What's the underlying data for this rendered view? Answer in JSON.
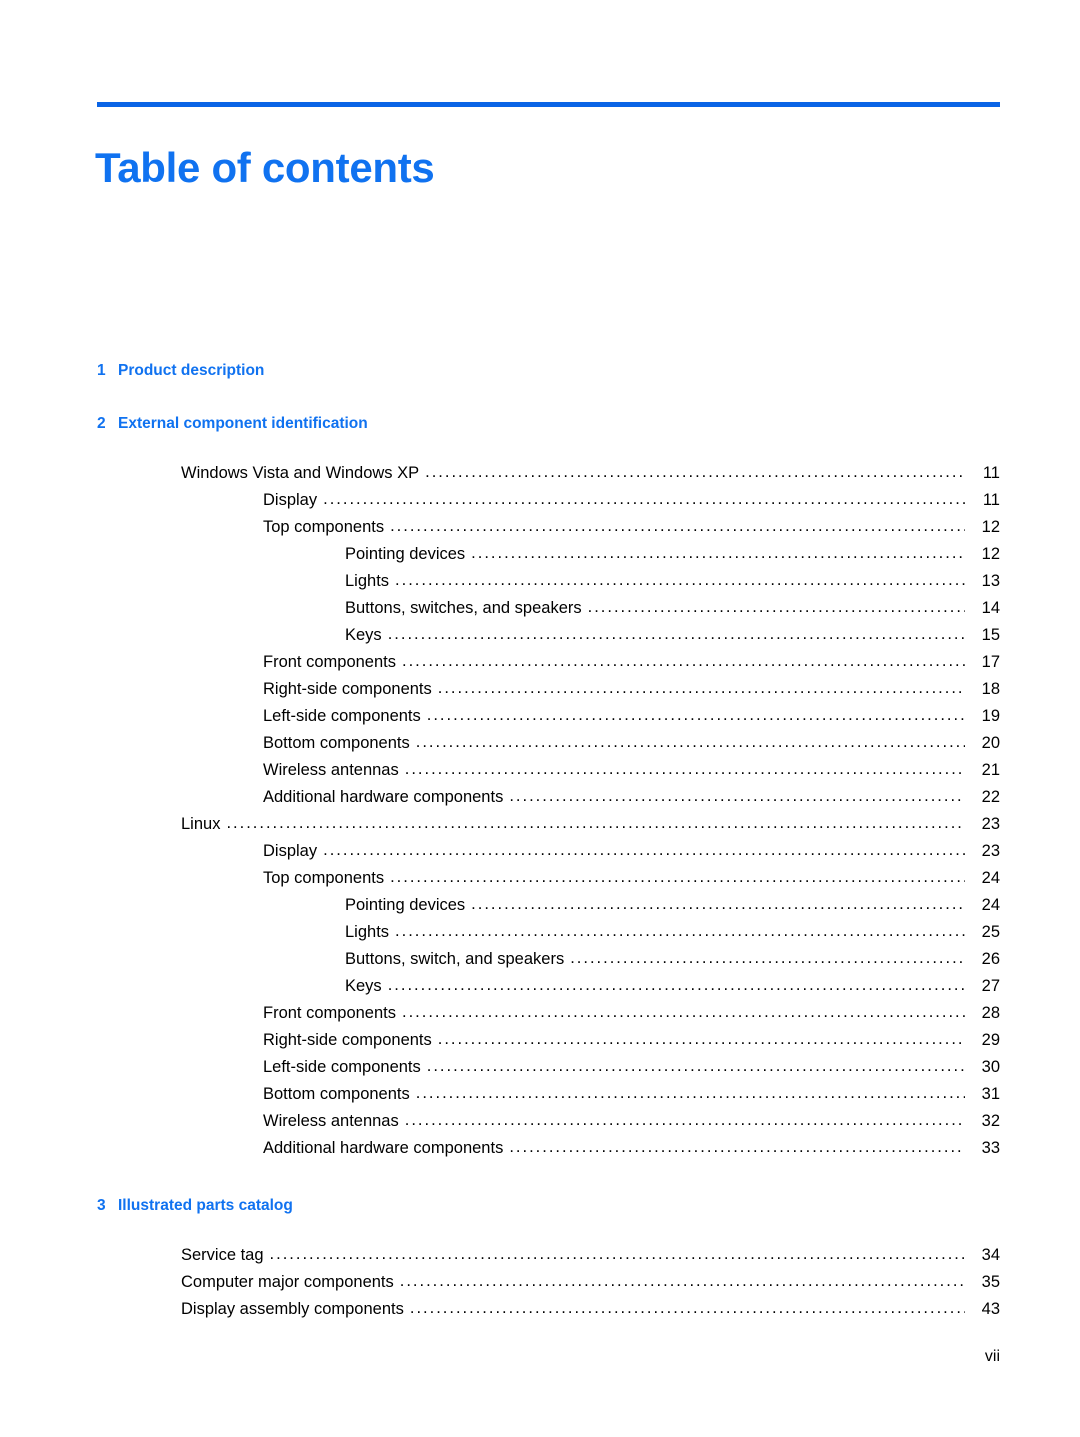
{
  "document": {
    "title": "Table of contents",
    "accent_color": "#1072F0",
    "rule_color": "#0A64E6",
    "footer_page_number": "vii"
  },
  "leader_dots": "...........................................................................................................................................................................................................................................",
  "chapters": [
    {
      "number": "1",
      "label": "Product description",
      "entries": []
    },
    {
      "number": "2",
      "label": "External component identification",
      "entries": [
        {
          "level": 1,
          "text": "Windows Vista and Windows XP",
          "page": "11"
        },
        {
          "level": 2,
          "text": "Display",
          "page": "11"
        },
        {
          "level": 2,
          "text": "Top components",
          "page": "12"
        },
        {
          "level": 3,
          "text": "Pointing devices",
          "page": "12"
        },
        {
          "level": 3,
          "text": "Lights",
          "page": "13"
        },
        {
          "level": 3,
          "text": "Buttons, switches, and speakers",
          "page": "14"
        },
        {
          "level": 3,
          "text": "Keys",
          "page": "15"
        },
        {
          "level": 2,
          "text": "Front components",
          "page": "17"
        },
        {
          "level": 2,
          "text": "Right-side components",
          "page": "18"
        },
        {
          "level": 2,
          "text": "Left-side components",
          "page": "19"
        },
        {
          "level": 2,
          "text": "Bottom components",
          "page": "20"
        },
        {
          "level": 2,
          "text": "Wireless antennas",
          "page": "21"
        },
        {
          "level": 2,
          "text": "Additional hardware components",
          "page": "22"
        },
        {
          "level": 1,
          "text": "Linux",
          "page": "23"
        },
        {
          "level": 2,
          "text": "Display",
          "page": "23"
        },
        {
          "level": 2,
          "text": "Top components",
          "page": "24"
        },
        {
          "level": 3,
          "text": "Pointing devices",
          "page": "24"
        },
        {
          "level": 3,
          "text": "Lights",
          "page": "25"
        },
        {
          "level": 3,
          "text": "Buttons, switch, and speakers",
          "page": "26"
        },
        {
          "level": 3,
          "text": "Keys",
          "page": "27"
        },
        {
          "level": 2,
          "text": "Front components",
          "page": "28"
        },
        {
          "level": 2,
          "text": "Right-side components",
          "page": "29"
        },
        {
          "level": 2,
          "text": "Left-side components",
          "page": "30"
        },
        {
          "level": 2,
          "text": "Bottom components",
          "page": "31"
        },
        {
          "level": 2,
          "text": "Wireless antennas",
          "page": "32"
        },
        {
          "level": 2,
          "text": "Additional hardware components",
          "page": "33"
        }
      ]
    },
    {
      "number": "3",
      "label": "Illustrated parts catalog",
      "entries": [
        {
          "level": 1,
          "text": "Service tag",
          "page": "34"
        },
        {
          "level": 1,
          "text": "Computer major components",
          "page": "35"
        },
        {
          "level": 1,
          "text": "Display assembly components",
          "page": "43"
        }
      ]
    }
  ]
}
